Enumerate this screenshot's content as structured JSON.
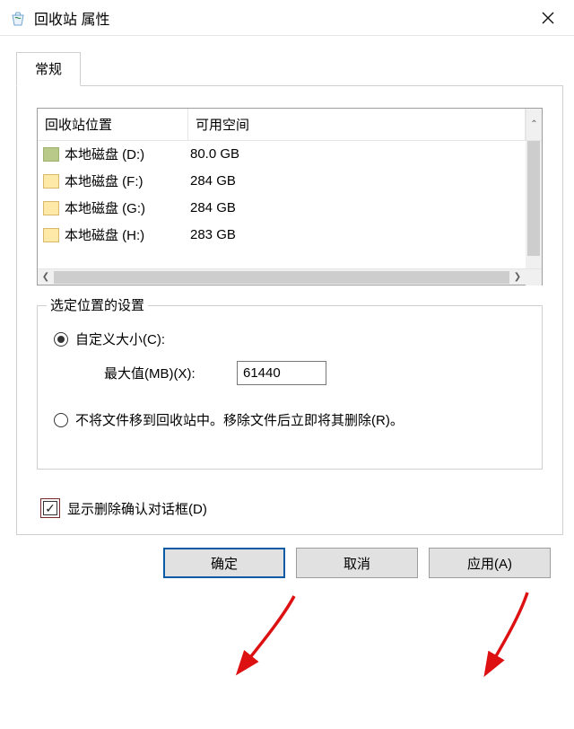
{
  "title": "回收站 属性",
  "tab_general": "常规",
  "columns": {
    "location": "回收站位置",
    "space": "可用空间"
  },
  "drives": [
    {
      "name": "本地磁盘 (D:)",
      "space": "80.0 GB",
      "color": "green"
    },
    {
      "name": "本地磁盘 (F:)",
      "space": "284 GB",
      "color": ""
    },
    {
      "name": "本地磁盘 (G:)",
      "space": "284 GB",
      "color": ""
    },
    {
      "name": "本地磁盘 (H:)",
      "space": "283 GB",
      "color": ""
    }
  ],
  "group": {
    "legend": "选定位置的设置",
    "radio_custom": "自定义大小(C):",
    "max_label": "最大值(MB)(X):",
    "max_value": "61440",
    "radio_remove": "不将文件移到回收站中。移除文件后立即将其删除(R)。"
  },
  "check_confirm": "显示删除确认对话框(D)",
  "buttons": {
    "ok": "确定",
    "cancel": "取消",
    "apply": "应用(A)"
  }
}
